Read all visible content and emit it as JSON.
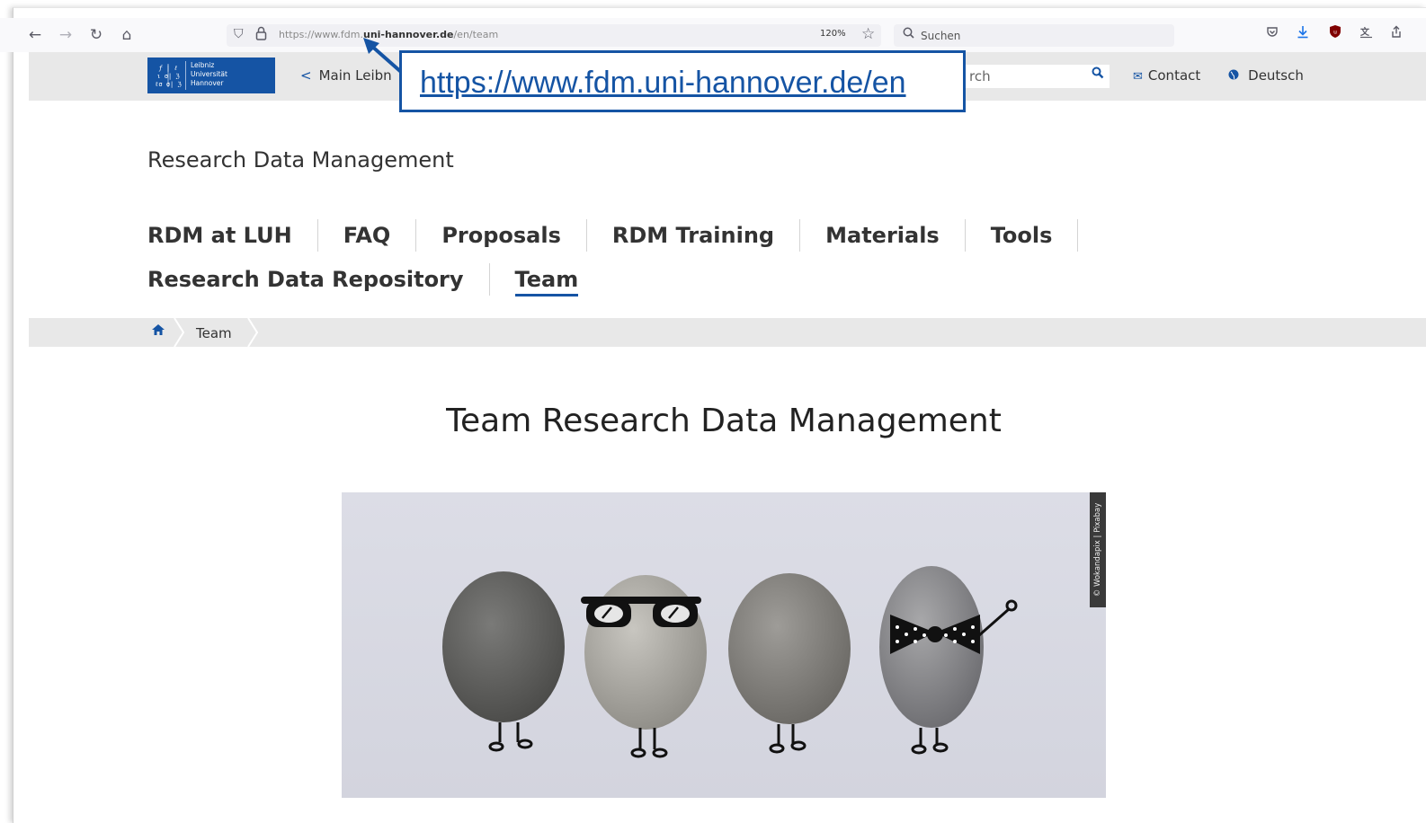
{
  "browser": {
    "url_prefix": "https://www.fdm.",
    "url_domain": "uni-hannover.de",
    "url_path": "/en/team",
    "zoom": "120%",
    "search_placeholder": "Suchen"
  },
  "header": {
    "logo_text_line1": "Leibniz",
    "logo_text_line2": "Universität",
    "logo_text_line3": "Hannover",
    "back_link": "Main Leibn",
    "search_placeholder": "rch",
    "contact": "Contact",
    "language": "Deutsch"
  },
  "callout": {
    "link": "https://www.fdm.uni-hannover.de/en"
  },
  "site_title": "Research Data Management",
  "nav": {
    "row1": [
      "RDM at LUH",
      "FAQ",
      "Proposals",
      "RDM Training",
      "Materials",
      "Tools"
    ],
    "row2": [
      "Research Data Repository",
      "Team"
    ]
  },
  "breadcrumb": {
    "current": "Team"
  },
  "page": {
    "heading": "Team Research Data Management",
    "image_credit": "© Wokandapix | Pixabay"
  },
  "colors": {
    "brand_blue": "#1554a4",
    "header_gray": "#e8e8e8"
  }
}
